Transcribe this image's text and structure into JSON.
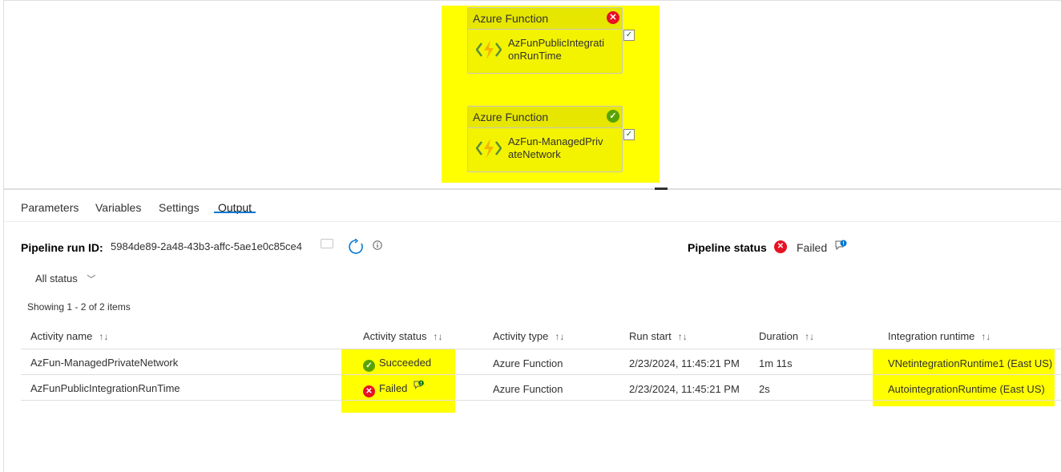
{
  "canvas": {
    "activities": [
      {
        "type_label": "Azure Function",
        "name": "AzFunPublicIntegrationRunTime",
        "status": "failed"
      },
      {
        "type_label": "Azure Function",
        "name": "AzFun-ManagedPrivateNetwork",
        "status": "succeeded"
      }
    ]
  },
  "tabs": [
    "Parameters",
    "Variables",
    "Settings",
    "Output"
  ],
  "active_tab": "Output",
  "run": {
    "id_label": "Pipeline run ID:",
    "id_value": "5984de89-2a48-43b3-affc-5ae1e0c85ce4",
    "status_label": "Pipeline status",
    "status_value": "Failed"
  },
  "filter": {
    "label": "All status"
  },
  "showing": "Showing 1 - 2 of 2 items",
  "table": {
    "columns": [
      "Activity name",
      "Activity status",
      "Activity type",
      "Run start",
      "Duration",
      "Integration runtime"
    ],
    "rows": [
      {
        "name": "AzFun-ManagedPrivateNetwork",
        "status": "Succeeded",
        "type": "Azure Function",
        "start": "2/23/2024, 11:45:21 PM",
        "duration": "1m 11s",
        "runtime": "VNetintegrationRuntime1 (East US)"
      },
      {
        "name": "AzFunPublicIntegrationRunTime",
        "status": "Failed",
        "type": "Azure Function",
        "start": "2/23/2024, 11:45:21 PM",
        "duration": "2s",
        "runtime": "AutointegrationRuntime (East US)"
      }
    ]
  },
  "colors": {
    "success": "#57a300",
    "error": "#e81123",
    "accent": "#0078d4",
    "highlight": "#ffff00"
  }
}
